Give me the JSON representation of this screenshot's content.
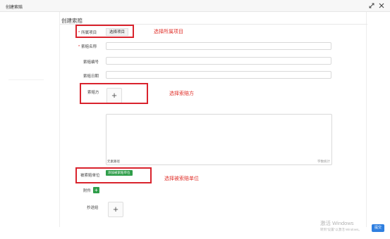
{
  "window": {
    "title": "创建索赔",
    "icons": [
      "expand-icon",
      "close-icon"
    ]
  },
  "form": {
    "section_title": "创建索赔",
    "project_label": "所属项目",
    "project_select": "选择项目",
    "claim_name_label": "索赔名称",
    "claim_no_label": "索赔编号",
    "claim_date_label": "索赔日期",
    "claimant_label": "索赔方",
    "textarea_hint": "元素路径",
    "textarea_count": "字数统计",
    "respondent_label": "被索赔单位",
    "add_respondent_button": "添加被索赔单位",
    "attachment_label": "附件",
    "cc_label": "抄送给"
  },
  "annotations": {
    "select_project": "选择所属项目",
    "select_claimant": "选择索赔方",
    "select_respondent": "选择被索赔单位"
  },
  "watermark": {
    "line1": "激活 Windows",
    "line2": "转到\"设置\"以激活 Windows。"
  },
  "footer": {
    "submit_label": "提交"
  },
  "colors": {
    "required": "#e02020",
    "annotation": "#d9232d",
    "green": "#2f9e4a",
    "primary": "#2f7fe0"
  }
}
